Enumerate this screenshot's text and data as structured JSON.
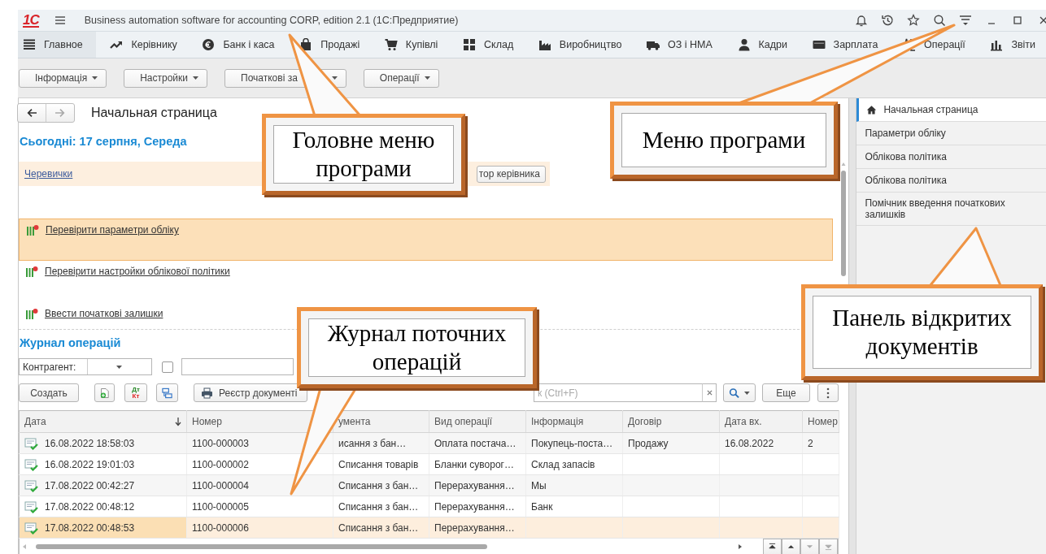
{
  "title_bar": {
    "logo": "1С",
    "title": "Business automation software for accounting CORP, edition 2.1 (1С:Предприятие)"
  },
  "sections": [
    {
      "label": "Главное",
      "selected": true
    },
    {
      "label": "Керівнику",
      "selected": false
    },
    {
      "label": "Банк і каса",
      "selected": false
    },
    {
      "label": "Продажі",
      "selected": false
    },
    {
      "label": "Купівлі",
      "selected": false
    },
    {
      "label": "Склад",
      "selected": false
    },
    {
      "label": "Виробництво",
      "selected": false
    },
    {
      "label": "ОЗ і НМА",
      "selected": false
    },
    {
      "label": "Кадри",
      "selected": false
    },
    {
      "label": "Зарплата",
      "selected": false
    },
    {
      "label": "Операції",
      "selected": false
    },
    {
      "label": "Звіти",
      "selected": false
    }
  ],
  "commands": [
    "Інформація",
    "Настройки",
    "Початкові за",
    "Операції"
  ],
  "start_page": {
    "title": "Начальная страница",
    "today": "Сьогодні: 17 серпня, Середа",
    "notice_link": "Черевички",
    "notice_button": "тор керівника",
    "tasks": [
      {
        "label": "Перевірити параметри обліку",
        "selected": true
      },
      {
        "label": "Перевірити настройки облікової політики",
        "selected": false
      },
      {
        "label": "Ввести початкові залишки",
        "selected": false
      }
    ]
  },
  "journal": {
    "title": "Журнал операцій",
    "counterparty": {
      "label": "Контрагент:"
    },
    "filter_checkbox": {
      "checked": false
    },
    "create_button": "Создать",
    "dt_kt": [
      "Дт",
      "Кт"
    ],
    "register_button": "Реєстр документі",
    "search": {
      "placeholder": "к (Ctrl+F)"
    },
    "more_button": "Еще",
    "table": {
      "columns": [
        "Дата",
        "Номер",
        "умента",
        "Вид операції",
        "Інформація",
        "Договір",
        "Дата вх.",
        "Номер"
      ],
      "rows": [
        {
          "cells": [
            "16.08.2022 18:58:03",
            "1100-000003",
            "исання з бан…",
            "Оплата постача…",
            "Покупець-поста…",
            "Продажу",
            "16.08.2022",
            "2"
          ],
          "selected": false
        },
        {
          "cells": [
            "16.08.2022 19:01:03",
            "1100-000002",
            "Списання товарів",
            "Бланки суворог…",
            "Склад запасів"
          ],
          "selected": false
        },
        {
          "cells": [
            "17.08.2022 00:42:27",
            "1100-000004",
            "Списання з бан…",
            "Перерахування…",
            "Мы"
          ],
          "selected": false
        },
        {
          "cells": [
            "17.08.2022 00:48:12",
            "1100-000005",
            "Списання з бан…",
            "Перерахування…",
            "Банк"
          ],
          "selected": false
        },
        {
          "cells": [
            "17.08.2022 00:48:53",
            "1100-000006",
            "Списання з бан…",
            "Перерахування…"
          ],
          "selected": true
        }
      ]
    }
  },
  "open_documents": [
    {
      "label": "Начальная страница",
      "selected": true
    },
    {
      "label": "Параметри обліку",
      "selected": false
    },
    {
      "label": "Облікова політика",
      "selected": false
    },
    {
      "label": "Облікова політика",
      "selected": false
    },
    {
      "label": "Помічник введення початкових залишків",
      "selected": false
    }
  ],
  "callouts": [
    {
      "text": "Головне меню програми"
    },
    {
      "text": "Меню програми"
    },
    {
      "text": "Журнал поточних операцій"
    },
    {
      "text": "Панель відкритих документів"
    }
  ]
}
